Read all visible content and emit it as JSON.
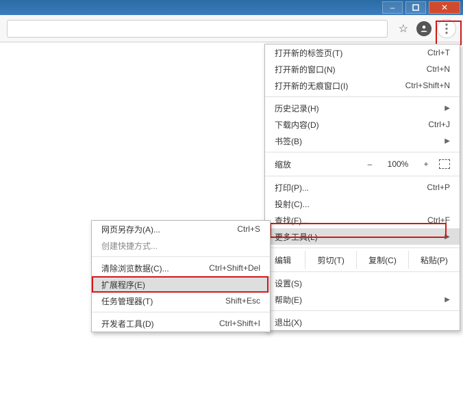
{
  "window": {
    "min": "–",
    "max": "▢",
    "close": "✕"
  },
  "toolbar": {
    "avatar_initial": ""
  },
  "main_menu": {
    "newtab": {
      "label": "打开新的标签页(T)",
      "shortcut": "Ctrl+T"
    },
    "newwindow": {
      "label": "打开新的窗口(N)",
      "shortcut": "Ctrl+N"
    },
    "incognito": {
      "label": "打开新的无痕窗口(I)",
      "shortcut": "Ctrl+Shift+N"
    },
    "history": {
      "label": "历史记录(H)"
    },
    "downloads": {
      "label": "下载内容(D)",
      "shortcut": "Ctrl+J"
    },
    "bookmarks": {
      "label": "书签(B)"
    },
    "zoom": {
      "label": "缩放",
      "minus": "–",
      "value": "100%",
      "plus": "+"
    },
    "print": {
      "label": "打印(P)...",
      "shortcut": "Ctrl+P"
    },
    "cast": {
      "label": "投射(C)..."
    },
    "find": {
      "label": "查找(F)...",
      "shortcut": "Ctrl+F"
    },
    "moretools": {
      "label": "更多工具(L)"
    },
    "edit": {
      "label": "编辑",
      "cut": "剪切(T)",
      "copy": "复制(C)",
      "paste": "粘贴(P)"
    },
    "settings": {
      "label": "设置(S)"
    },
    "help": {
      "label": "帮助(E)"
    },
    "exit": {
      "label": "退出(X)"
    }
  },
  "sub_menu": {
    "saveas": {
      "label": "网页另存为(A)...",
      "shortcut": "Ctrl+S"
    },
    "shortcut": {
      "label": "创建快捷方式..."
    },
    "clear": {
      "label": "清除浏览数据(C)...",
      "shortcut": "Ctrl+Shift+Del"
    },
    "extensions": {
      "label": "扩展程序(E)"
    },
    "taskmgr": {
      "label": "任务管理器(T)",
      "shortcut": "Shift+Esc"
    },
    "devtools": {
      "label": "开发者工具(D)",
      "shortcut": "Ctrl+Shift+I"
    }
  }
}
